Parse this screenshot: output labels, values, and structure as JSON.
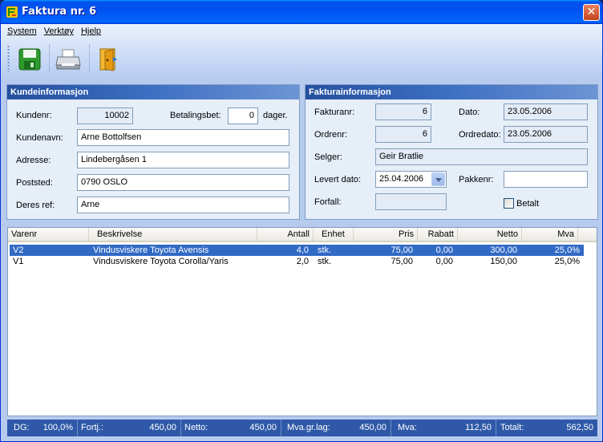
{
  "window": {
    "title": "Faktura nr. 6",
    "close_glyph": "✕"
  },
  "menu": [
    "System",
    "Verktøy",
    "Hjelp"
  ],
  "toolbar": [
    "save-icon",
    "print-icon",
    "exit-door-icon"
  ],
  "customer": {
    "heading": "Kundeinformasjon",
    "kundenr_label": "Kundenr:",
    "kundenr": "10002",
    "betalingsbet_label": "Betalingsbet:",
    "betalingsbet": "0",
    "dager": "dager.",
    "kundenavn_label": "Kundenavn:",
    "kundenavn": "Arne Bottolfsen",
    "adresse_label": "Adresse:",
    "adresse": "Lindebergåsen 1",
    "poststed_label": "Poststed:",
    "poststed": "0790 OSLO",
    "deres_ref_label": "Deres ref:",
    "deres_ref": "Arne"
  },
  "invoice": {
    "heading": "Fakturainformasjon",
    "fakturanr_label": "Fakturanr:",
    "fakturanr": "6",
    "dato_label": "Dato:",
    "dato": "23.05.2006",
    "ordrenr_label": "Ordrenr:",
    "ordrenr": "6",
    "ordredato_label": "Ordredato:",
    "ordredato": "23.05.2006",
    "selger_label": "Selger:",
    "selger": "Geir Bratlie",
    "levert_label": "Levert dato:",
    "levert": "25.04.2006",
    "pakkenr_label": "Pakkenr:",
    "pakkenr": "",
    "forfall_label": "Forfall:",
    "forfall": "",
    "betalt_label": "Betalt",
    "betalt": false
  },
  "lines": {
    "headers": [
      "Varenr",
      "Beskrivelse",
      "Antall",
      "Enhet",
      "Pris",
      "Rabatt",
      "Netto",
      "Mva"
    ],
    "rows": [
      [
        "V2",
        "Vindusviskere Toyota Avensis",
        "4,0",
        "stk.",
        "75,00",
        "0,00",
        "300,00",
        "25,0%"
      ],
      [
        "V1",
        "Vindusviskere Toyota Corolla/Yaris",
        "2,0",
        "stk.",
        "75,00",
        "0,00",
        "150,00",
        "25,0%"
      ]
    ],
    "selected_row": 0
  },
  "status": {
    "dg_label": "DG:",
    "dg": "100,0%",
    "fortj_label": "Fortj.:",
    "fortj": "450,00",
    "netto_label": "Netto:",
    "netto": "450,00",
    "mvagrlag_label": "Mva.gr.lag:",
    "mvagrlag": "450,00",
    "mva_label": "Mva:",
    "mva": "112,50",
    "totalt_label": "Totalt:",
    "totalt": "562,50"
  },
  "colors": {
    "selection": "#316ac5",
    "status_bar": "#2f59a8",
    "titlebar": "#0050ee"
  }
}
